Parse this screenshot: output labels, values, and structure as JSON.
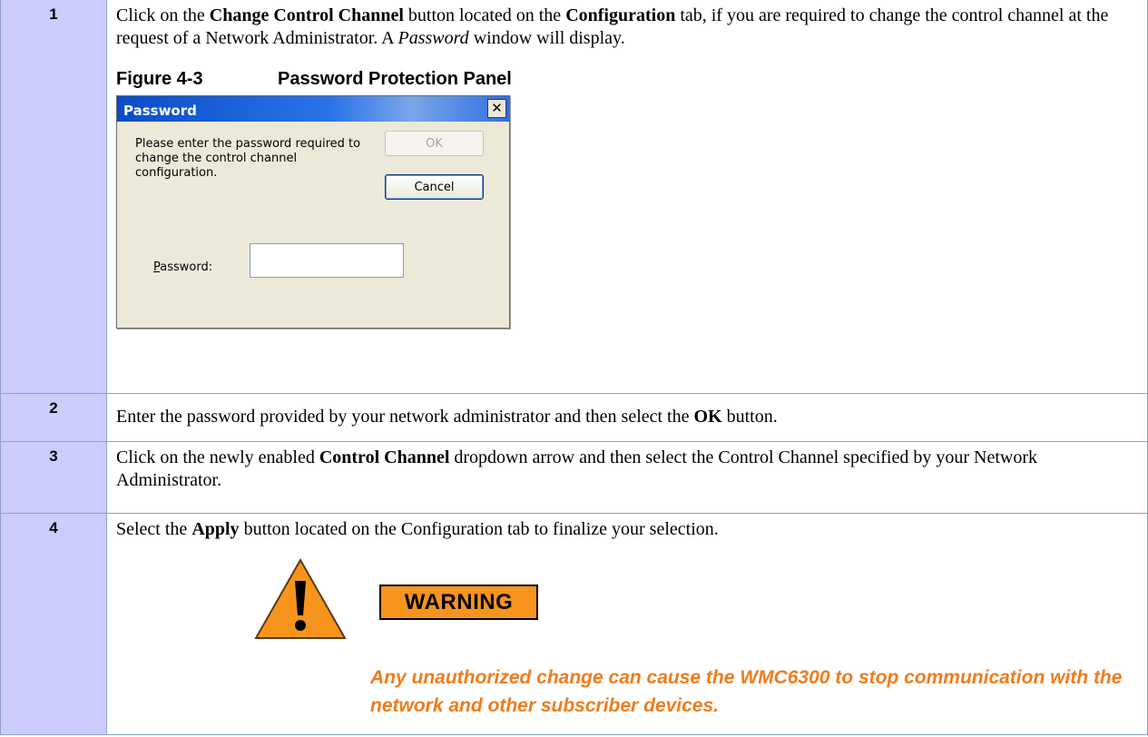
{
  "steps": [
    {
      "number": "1",
      "text_parts": {
        "p1": "Click on the ",
        "b1": "Change Control Channel",
        "p2": " button located on the ",
        "b2": "Configuration",
        "p3": " tab, if you are required to change the control channel at the request of a Network Administrator.  A ",
        "i1": "Password",
        "p4": " window will display."
      },
      "figure": {
        "number": "Figure 4-3",
        "caption": "Password Protection Panel"
      }
    },
    {
      "number": "2",
      "text_parts": {
        "p1": "Enter the password provided by your network administrator and then select the ",
        "b1": "OK",
        "p2": " button."
      }
    },
    {
      "number": "3",
      "text_parts": {
        "p1": "Click on the newly enabled ",
        "b1": "Control Channel",
        "p2": " dropdown arrow and then select the Control Channel specified by your Network Administrator."
      }
    },
    {
      "number": "4",
      "text_parts": {
        "p1": "Select the ",
        "b1": "Apply",
        "p2": " button located on the Configuration tab to finalize your selection."
      },
      "warning": {
        "label": "WARNING",
        "icon": "warning-triangle-icon",
        "message": "Any unauthorized change can cause the WMC6300 to stop communication with the network and other subscriber devices."
      }
    }
  ],
  "dialog": {
    "title": "Password",
    "close_glyph": "✕",
    "message": "Please enter the password required to change the control channel configuration.",
    "ok_label": "OK",
    "cancel_label": "Cancel",
    "password_label_accel": "P",
    "password_label_rest": "assword:",
    "password_value": ""
  },
  "colors": {
    "step_number_cell": "#ccccff",
    "table_border": "#8fa2c1",
    "warning_orange": "#f7941d",
    "warning_text": "#f07c1c",
    "dialog_title_blue": "#0a4cc8"
  }
}
